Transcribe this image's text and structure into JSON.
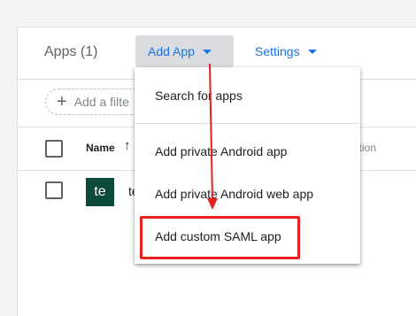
{
  "header": {
    "apps_title": "Apps (1)",
    "add_app_label": "Add App",
    "settings_label": "Settings"
  },
  "filter": {
    "placeholder": "Add a filte"
  },
  "table": {
    "columns": [
      "Name",
      "ation"
    ],
    "rows": [
      {
        "avatar_text": "te",
        "name_fragment": "te"
      }
    ]
  },
  "menu": {
    "items": [
      "Search for apps",
      "Add private Android app",
      "Add private Android web app",
      "Add custom SAML app"
    ],
    "highlighted_index": 3
  },
  "colors": {
    "accent": "#1a73e8",
    "annotation": "#e8201f",
    "avatar": "#0b4a3b"
  },
  "icons": [
    "chevron-down-icon",
    "plus-icon",
    "sort-arrow-up-icon",
    "annotation-arrow"
  ]
}
